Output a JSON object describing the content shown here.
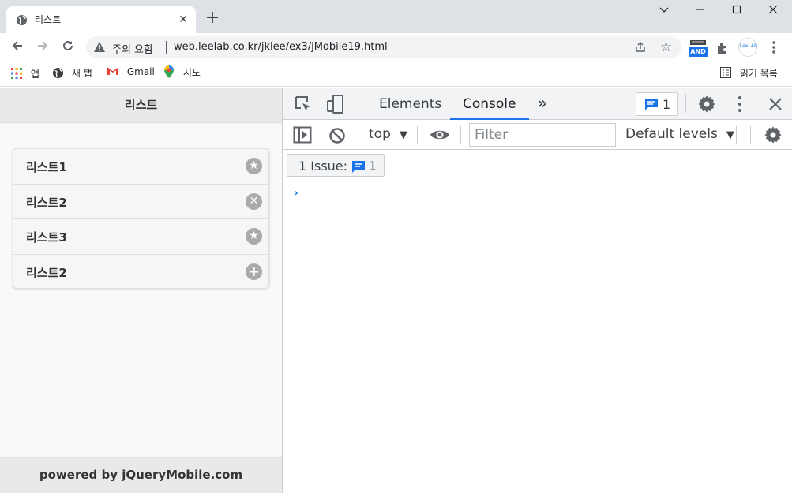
{
  "browser": {
    "tab_title": "리스트",
    "tab_close": "✕",
    "new_tab": "+",
    "security_label": "주의 요함",
    "url": "web.leelab.co.kr/jklee/ex3/jMobile19.html",
    "ext_badge": "AND",
    "profile_label": "LeeLAB"
  },
  "bookmarks": {
    "items": [
      "앱",
      "새 탭",
      "Gmail",
      "지도"
    ],
    "reading_list": "읽기 목록"
  },
  "page": {
    "header": "리스트",
    "items": [
      {
        "label": "리스트1",
        "icon": "star-icon",
        "glyph": "★"
      },
      {
        "label": "리스트2",
        "icon": "delete-icon",
        "glyph": "✕"
      },
      {
        "label": "리스트3",
        "icon": "star-icon",
        "glyph": "★"
      },
      {
        "label": "리스트2",
        "icon": "plus-icon",
        "glyph": "+"
      }
    ],
    "footer": "powered by jQueryMobile.com"
  },
  "devtools": {
    "tabs": [
      "Elements",
      "Console"
    ],
    "active_tab": "Console",
    "more_tabs": "»",
    "message_count": "1",
    "context": "top",
    "filter_placeholder": "Filter",
    "levels": "Default levels",
    "issue_label": "1 Issue:",
    "issue_count": "1",
    "prompt": "›"
  },
  "colors": {
    "accent": "#1a73e8",
    "icon_gray": "#aaaaaa"
  }
}
